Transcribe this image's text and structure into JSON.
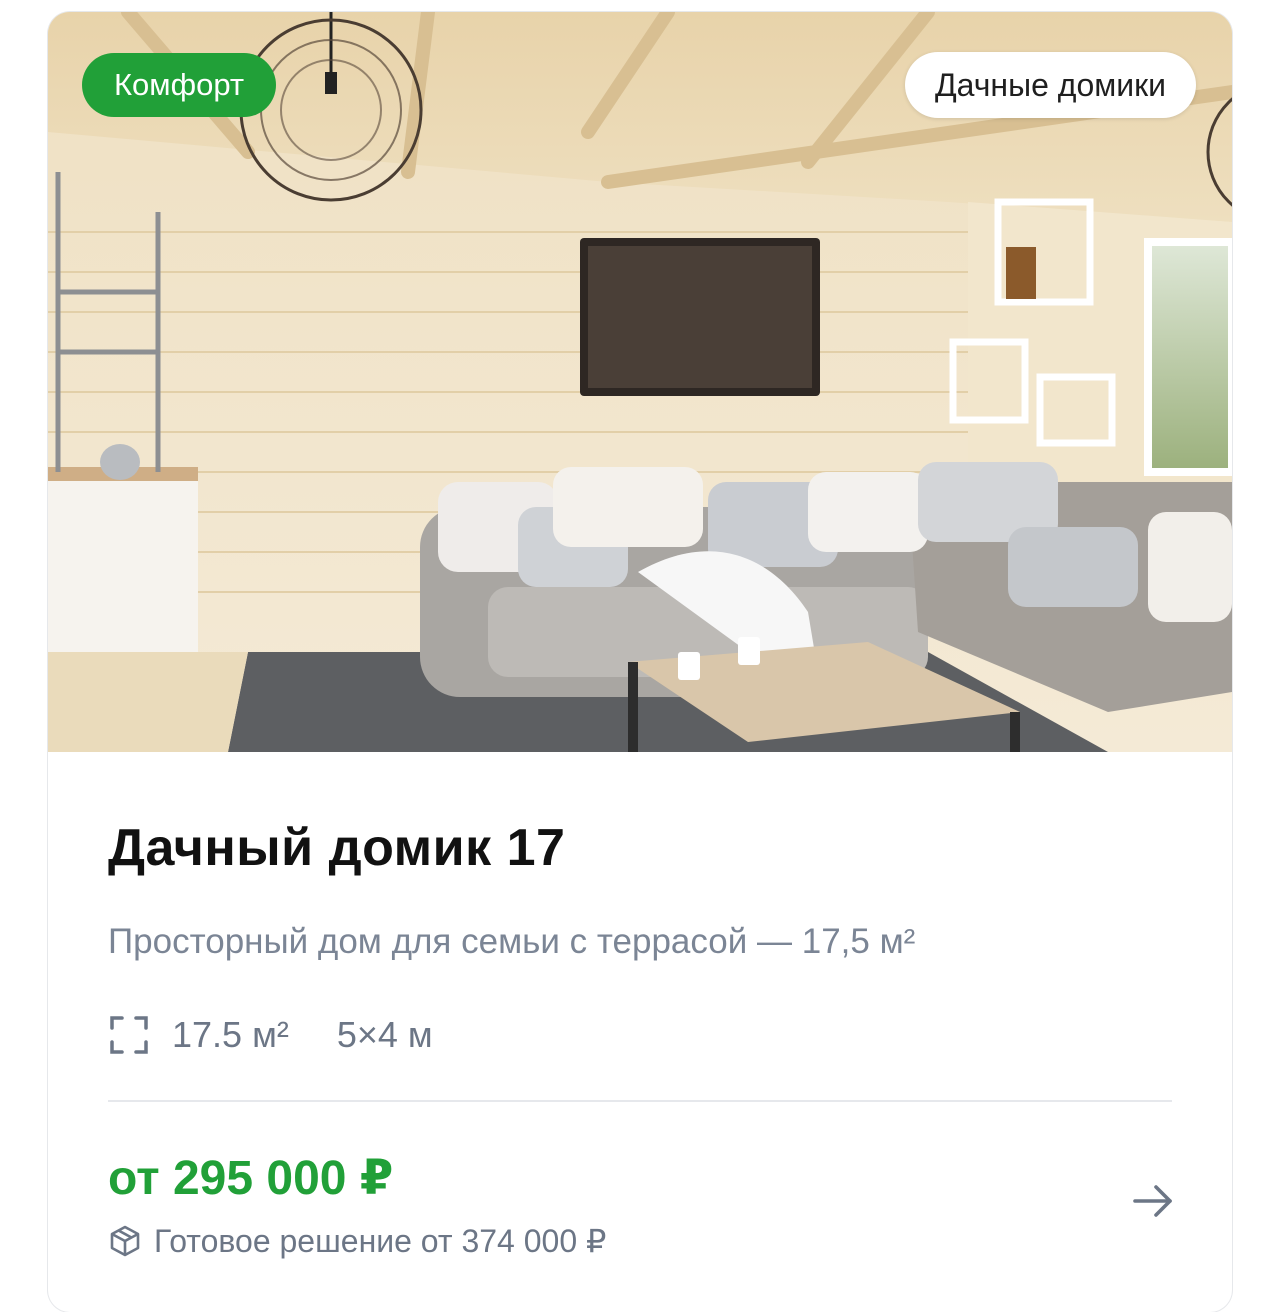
{
  "card": {
    "category_badge": "Комфорт",
    "type_badge": "Дачные домики",
    "title": "Дачный домик 17",
    "subtitle": "Просторный дом для семьи с террасой — 17,5 м²",
    "specs": {
      "area_icon": "area-frame-icon",
      "area": "17.5 м²",
      "dimensions": "5×4 м"
    },
    "price": "от 295 000 ₽",
    "ready_solution": {
      "icon": "package-box-icon",
      "text": "Готовое решение от 374 000 ₽"
    },
    "action_icon": "arrow-right-icon"
  },
  "colors": {
    "accent_green": "#21a038",
    "muted_text": "#6c7686",
    "title_text": "#111111"
  }
}
